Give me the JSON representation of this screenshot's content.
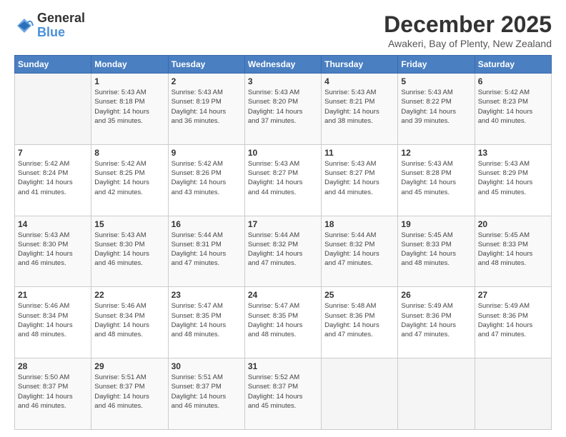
{
  "logo": {
    "general": "General",
    "blue": "Blue"
  },
  "header": {
    "month": "December 2025",
    "location": "Awakeri, Bay of Plenty, New Zealand"
  },
  "weekdays": [
    "Sunday",
    "Monday",
    "Tuesday",
    "Wednesday",
    "Thursday",
    "Friday",
    "Saturday"
  ],
  "weeks": [
    [
      {
        "day": "",
        "info": ""
      },
      {
        "day": "1",
        "info": "Sunrise: 5:43 AM\nSunset: 8:18 PM\nDaylight: 14 hours\nand 35 minutes."
      },
      {
        "day": "2",
        "info": "Sunrise: 5:43 AM\nSunset: 8:19 PM\nDaylight: 14 hours\nand 36 minutes."
      },
      {
        "day": "3",
        "info": "Sunrise: 5:43 AM\nSunset: 8:20 PM\nDaylight: 14 hours\nand 37 minutes."
      },
      {
        "day": "4",
        "info": "Sunrise: 5:43 AM\nSunset: 8:21 PM\nDaylight: 14 hours\nand 38 minutes."
      },
      {
        "day": "5",
        "info": "Sunrise: 5:43 AM\nSunset: 8:22 PM\nDaylight: 14 hours\nand 39 minutes."
      },
      {
        "day": "6",
        "info": "Sunrise: 5:42 AM\nSunset: 8:23 PM\nDaylight: 14 hours\nand 40 minutes."
      }
    ],
    [
      {
        "day": "7",
        "info": "Sunrise: 5:42 AM\nSunset: 8:24 PM\nDaylight: 14 hours\nand 41 minutes."
      },
      {
        "day": "8",
        "info": "Sunrise: 5:42 AM\nSunset: 8:25 PM\nDaylight: 14 hours\nand 42 minutes."
      },
      {
        "day": "9",
        "info": "Sunrise: 5:42 AM\nSunset: 8:26 PM\nDaylight: 14 hours\nand 43 minutes."
      },
      {
        "day": "10",
        "info": "Sunrise: 5:43 AM\nSunset: 8:27 PM\nDaylight: 14 hours\nand 44 minutes."
      },
      {
        "day": "11",
        "info": "Sunrise: 5:43 AM\nSunset: 8:27 PM\nDaylight: 14 hours\nand 44 minutes."
      },
      {
        "day": "12",
        "info": "Sunrise: 5:43 AM\nSunset: 8:28 PM\nDaylight: 14 hours\nand 45 minutes."
      },
      {
        "day": "13",
        "info": "Sunrise: 5:43 AM\nSunset: 8:29 PM\nDaylight: 14 hours\nand 45 minutes."
      }
    ],
    [
      {
        "day": "14",
        "info": "Sunrise: 5:43 AM\nSunset: 8:30 PM\nDaylight: 14 hours\nand 46 minutes."
      },
      {
        "day": "15",
        "info": "Sunrise: 5:43 AM\nSunset: 8:30 PM\nDaylight: 14 hours\nand 46 minutes."
      },
      {
        "day": "16",
        "info": "Sunrise: 5:44 AM\nSunset: 8:31 PM\nDaylight: 14 hours\nand 47 minutes."
      },
      {
        "day": "17",
        "info": "Sunrise: 5:44 AM\nSunset: 8:32 PM\nDaylight: 14 hours\nand 47 minutes."
      },
      {
        "day": "18",
        "info": "Sunrise: 5:44 AM\nSunset: 8:32 PM\nDaylight: 14 hours\nand 47 minutes."
      },
      {
        "day": "19",
        "info": "Sunrise: 5:45 AM\nSunset: 8:33 PM\nDaylight: 14 hours\nand 48 minutes."
      },
      {
        "day": "20",
        "info": "Sunrise: 5:45 AM\nSunset: 8:33 PM\nDaylight: 14 hours\nand 48 minutes."
      }
    ],
    [
      {
        "day": "21",
        "info": "Sunrise: 5:46 AM\nSunset: 8:34 PM\nDaylight: 14 hours\nand 48 minutes."
      },
      {
        "day": "22",
        "info": "Sunrise: 5:46 AM\nSunset: 8:34 PM\nDaylight: 14 hours\nand 48 minutes."
      },
      {
        "day": "23",
        "info": "Sunrise: 5:47 AM\nSunset: 8:35 PM\nDaylight: 14 hours\nand 48 minutes."
      },
      {
        "day": "24",
        "info": "Sunrise: 5:47 AM\nSunset: 8:35 PM\nDaylight: 14 hours\nand 48 minutes."
      },
      {
        "day": "25",
        "info": "Sunrise: 5:48 AM\nSunset: 8:36 PM\nDaylight: 14 hours\nand 47 minutes."
      },
      {
        "day": "26",
        "info": "Sunrise: 5:49 AM\nSunset: 8:36 PM\nDaylight: 14 hours\nand 47 minutes."
      },
      {
        "day": "27",
        "info": "Sunrise: 5:49 AM\nSunset: 8:36 PM\nDaylight: 14 hours\nand 47 minutes."
      }
    ],
    [
      {
        "day": "28",
        "info": "Sunrise: 5:50 AM\nSunset: 8:37 PM\nDaylight: 14 hours\nand 46 minutes."
      },
      {
        "day": "29",
        "info": "Sunrise: 5:51 AM\nSunset: 8:37 PM\nDaylight: 14 hours\nand 46 minutes."
      },
      {
        "day": "30",
        "info": "Sunrise: 5:51 AM\nSunset: 8:37 PM\nDaylight: 14 hours\nand 46 minutes."
      },
      {
        "day": "31",
        "info": "Sunrise: 5:52 AM\nSunset: 8:37 PM\nDaylight: 14 hours\nand 45 minutes."
      },
      {
        "day": "",
        "info": ""
      },
      {
        "day": "",
        "info": ""
      },
      {
        "day": "",
        "info": ""
      }
    ]
  ]
}
